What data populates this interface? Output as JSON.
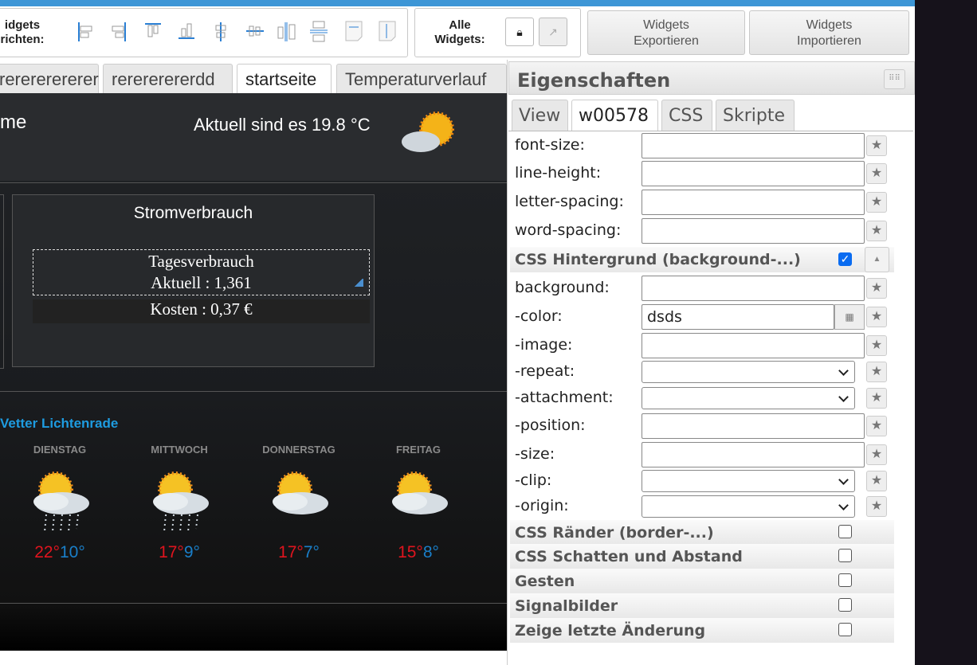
{
  "toolbar": {
    "align_label_line1": "idgets",
    "align_label_line2": "richten:",
    "all_widgets_line1": "Alle",
    "all_widgets_line2": "Widgets:",
    "export_line1": "Widgets",
    "export_line2": "Exportieren",
    "import_line1": "Widgets",
    "import_line2": "Importieren"
  },
  "view_tabs": [
    {
      "label": "rerererererer"
    },
    {
      "label": "rerererererdd"
    },
    {
      "label": "startseite",
      "active": true
    },
    {
      "label": "Temperaturverlauf"
    }
  ],
  "canvas": {
    "title_fragment": "me",
    "current_temp": "Aktuell sind es 19.8 °C",
    "power_title": "Stromverbrauch",
    "daily_line1": "Tagesverbrauch",
    "daily_line2": "Aktuell : 1,361",
    "costs": "Kosten : 0,37 €",
    "weather_title": "Vetter Lichtenrade",
    "forecast": [
      {
        "day": "DIENSTAG",
        "hi": "22°",
        "lo": "10°",
        "icon": "sun-cloud-rain-icon"
      },
      {
        "day": "MITTWOCH",
        "hi": "17°",
        "lo": "9°",
        "icon": "sun-cloud-rain-icon"
      },
      {
        "day": "DONNERSTAG",
        "hi": "17°",
        "lo": "7°",
        "icon": "sun-cloud-icon"
      },
      {
        "day": "FREITAG",
        "hi": "15°",
        "lo": "8°",
        "icon": "sun-cloud-icon"
      }
    ]
  },
  "panel": {
    "title": "Eigenschaften",
    "tabs": [
      {
        "label": "View"
      },
      {
        "label": "w00578",
        "active": true
      },
      {
        "label": "CSS"
      },
      {
        "label": "Skripte"
      }
    ],
    "rows": [
      {
        "label": "font-size:",
        "value": ""
      },
      {
        "label": "line-height:",
        "value": ""
      },
      {
        "label": "letter-spacing:",
        "value": ""
      },
      {
        "label": "word-spacing:",
        "value": ""
      }
    ],
    "bg_section": "CSS Hintergrund (background-...)",
    "bg_checked": true,
    "bg_rows": [
      {
        "label": "background:",
        "value": ""
      },
      {
        "label": "-color:",
        "value": "dsds"
      },
      {
        "label": "-image:",
        "value": ""
      },
      {
        "label": "-repeat:",
        "value": ""
      },
      {
        "label": "-attachment:",
        "value": ""
      },
      {
        "label": "-position:",
        "value": ""
      },
      {
        "label": "-size:",
        "value": ""
      },
      {
        "label": "-clip:",
        "value": ""
      },
      {
        "label": "-origin:",
        "value": ""
      }
    ],
    "sections": [
      {
        "label": "CSS Ränder (border-...)",
        "checked": false
      },
      {
        "label": "CSS Schatten und Abstand",
        "checked": false
      },
      {
        "label": "Gesten",
        "checked": false
      },
      {
        "label": "Signalbilder",
        "checked": false
      },
      {
        "label": "Zeige letzte Änderung",
        "checked": false
      }
    ]
  },
  "colors": {
    "accent": "#3d96d6",
    "weather_title": "#1e9be0",
    "temp_high": "#e0141e",
    "temp_low": "#1a7fc9"
  }
}
